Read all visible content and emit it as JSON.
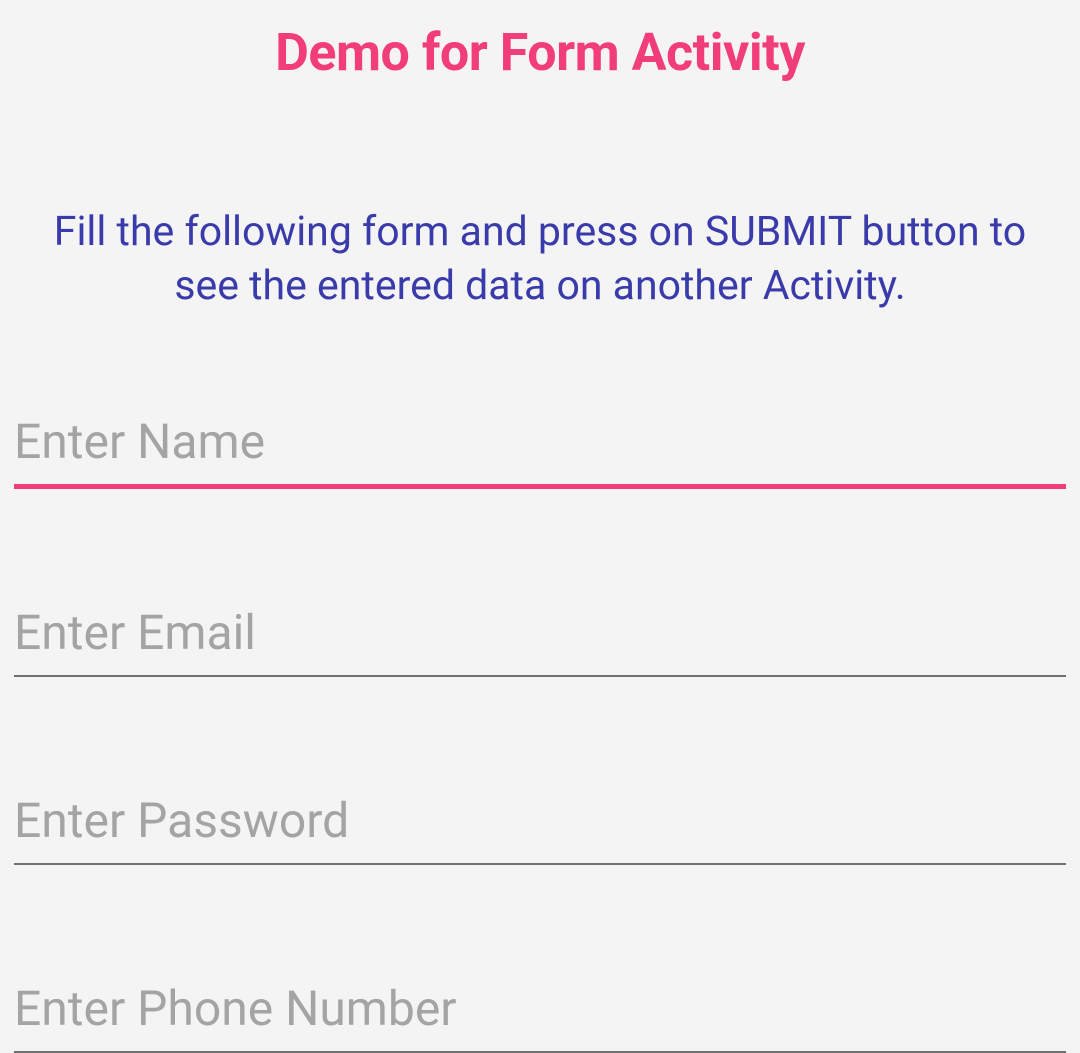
{
  "title": "Demo for Form Activity",
  "instruction": "Fill the following form and press on SUBMIT button to see the entered data on another Activity.",
  "fields": {
    "name": {
      "placeholder": "Enter Name",
      "value": ""
    },
    "email": {
      "placeholder": "Enter Email",
      "value": ""
    },
    "password": {
      "placeholder": "Enter Password",
      "value": ""
    },
    "phone": {
      "placeholder": "Enter Phone Number",
      "value": ""
    }
  },
  "colors": {
    "accent": "#f13d79",
    "instruction_text": "#3a3bab",
    "placeholder": "#a4a4a4",
    "underline_inactive": "#707070",
    "background": "#f4f4f4"
  }
}
